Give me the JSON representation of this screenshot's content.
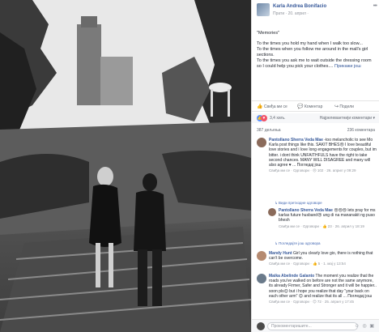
{
  "post": {
    "author": "Karla Andrea Bonifacio",
    "meta": "Прати · 20. април ·",
    "caption_lines": [
      "\"Memories\"",
      "To the times you hold my hand when I walk too slow...",
      "To the times when you follow me around in the mall's girl sections.",
      "To the times you ask me to wait outside the dressing room so I could help you pick your clothes....",
      "Прикажи још"
    ]
  },
  "actions": {
    "like": "Свиђа ми се",
    "comment": "Коментар",
    "share": "Подели"
  },
  "reactions": {
    "count": "3,4 хиљ.",
    "sort": "Најрелевантнији коментари ▾"
  },
  "stats": {
    "shares": "387 дељења",
    "comments": "236 коментара"
  },
  "comments": [
    {
      "name": "Pantollano Sherra Veda Mae",
      "text": "-too melancholic to see Mo Karla post things like this. SAKIT BHES😢 I love beautiful love stories and i love long engagements for couples, but im bitter. i dont think UNFAITHFULS have the right to take second chances. MANY WILL DISAGREE and many will also agree ♥ ... Погледај још",
      "links": "Свиђа ми се · Одговори · 😢 102 · 26. април у 09:29"
    },
    {
      "name": "Pantollano Sherra Veda Mae",
      "text": "😢😢😢 lets pray for ms karlas future husband😢 ung di na mananakit ng puso bhesh",
      "links": "Свиђа ми се · Одговори · 👍 23 · 26. април у 18:19"
    },
    {
      "name": "Mandy Hunt",
      "text": "Girl you clearly love gio, there is nothing that can't be overcome.",
      "links": "Свиђа ми се · Одговори · 👍 5 · 1. мај у 13:54"
    },
    {
      "name": "Maika Abelinde Galanto",
      "text": "The moment you realize that the roads you've walked on before are not the same anymore, its already Firmer, Safer and Stronger and it will be happier.. soon pls😊 but i hope you realize that day \"your back on each other arm\" 😊 and realize that its all ... Погледај још",
      "links": "Свиђа ми се · Одговори · 😊 72 · 25. април у 17:45"
    }
  ],
  "reply_links": [
    "↳ Види претходне одговоре",
    "↳ Погледајте још одговора"
  ],
  "composer": {
    "placeholder": "Прокоментаришите..."
  }
}
